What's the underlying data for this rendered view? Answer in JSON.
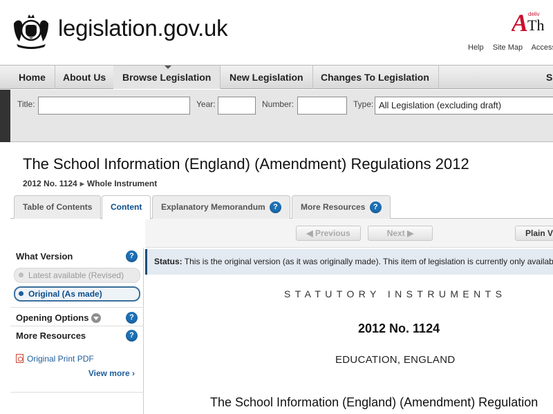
{
  "header": {
    "site_name": "legislation.gov.uk",
    "brand_small": "deliv",
    "brand_partial": "Th",
    "util_links": [
      "Help",
      "Site Map",
      "Accessi"
    ]
  },
  "nav": {
    "items": [
      "Home",
      "About Us",
      "Browse Legislation",
      "New Legislation",
      "Changes To Legislation"
    ],
    "extra": "S"
  },
  "search": {
    "title_label": "Title:",
    "year_label": "Year:",
    "number_label": "Number:",
    "type_label": "Type:",
    "type_value": "All Legislation (excluding draft)"
  },
  "document": {
    "title": "The School Information (England) (Amendment) Regulations 2012",
    "breadcrumb_ref": "2012 No. 1124",
    "breadcrumb_current": "Whole Instrument"
  },
  "tabs": [
    {
      "label": "Table of Contents",
      "active": false
    },
    {
      "label": "Content",
      "active": true
    },
    {
      "label": "Explanatory Memorandum",
      "active": false,
      "help": "?"
    },
    {
      "label": "More Resources",
      "active": false,
      "help": "?"
    }
  ],
  "pager": {
    "previous": "Previous",
    "next": "Next",
    "plain_view": "Plain V"
  },
  "sidebar": {
    "what_version": "What Version",
    "latest": "Latest available (Revised)",
    "original": "Original (As made)",
    "opening_options": "Opening Options",
    "more_resources": "More Resources",
    "pdf": "Original Print PDF",
    "view_more": "View more",
    "help": "?"
  },
  "content": {
    "status_label": "Status:",
    "status_text": " This is the original version (as it was originally made). This item of legislation is currently only available",
    "si_heading": "STATUTORY INSTRUMENTS",
    "si_number": "2012 No. 1124",
    "si_subject": "EDUCATION, ENGLAND",
    "si_title": "The School Information (England) (Amendment) Regulation"
  },
  "colors": {
    "brand_red": "#c8102e",
    "link_blue": "#1d5d9b",
    "help_blue": "#1d6fb4",
    "status_bg": "#e4eaf1"
  }
}
